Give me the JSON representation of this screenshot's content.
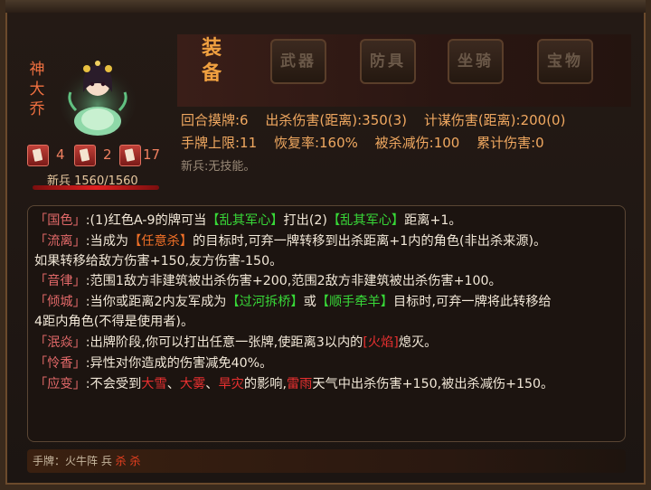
{
  "general": {
    "name": "神大乔",
    "stats": [
      {
        "icon": "card-icon",
        "value": "4"
      },
      {
        "icon": "sword-icon",
        "value": "2"
      },
      {
        "icon": "shield-icon",
        "value": "17"
      }
    ],
    "hp_label": "新兵 1560/1560",
    "hp_fraction": 1.0
  },
  "equipment": {
    "title": "装备",
    "slots": [
      "武器",
      "防具",
      "坐骑",
      "宝物"
    ]
  },
  "attributes": {
    "row1": [
      "回合摸牌:6",
      "出杀伤害(距离):350(3)",
      "计谋伤害(距离):200(0)"
    ],
    "row2": [
      "手牌上限:11",
      "恢复率:160%",
      "被杀减伤:100",
      "累计伤害:0"
    ],
    "no_skill": "新兵:无技能。"
  },
  "skills": {
    "l1": {
      "name": "「国色」",
      "a": ":(1)红色A-9的牌可当",
      "b": "【乱其军心】",
      "c": "打出(2)",
      "d": "【乱其军心】",
      "e": "距离+1。"
    },
    "l2": {
      "name": "「流离」",
      "a": ":当成为",
      "b": "【任意杀】",
      "c": "的目标时,可弃一牌转移到出杀距离+1内的角色(非出杀来源)。"
    },
    "l3": {
      "a": "如果转移给敌方伤害+150,友方伤害-150。"
    },
    "l4": {
      "name": "「音律」",
      "a": ":范围1敌方非建筑被出杀伤害+200,范围2敌方非建筑被出杀伤害+100。"
    },
    "l5": {
      "name": "「倾城」",
      "a": ":当你或距离2内友军成为",
      "b": "【过河拆桥】",
      "c": "或",
      "d": "【顺手牵羊】",
      "e": "目标时,可弃一牌将此转移给"
    },
    "l6": {
      "a": "4距内角色(不得是使用者)。"
    },
    "l7": {
      "name": "「泯焱」",
      "a": ":出牌阶段,你可以打出任意一张牌,使距离3以内的",
      "b": "[火焰]",
      "c": "熄灭。"
    },
    "l8": {
      "name": "「怜香」",
      "a": ":异性对你造成的伤害减免40%。"
    },
    "l9": {
      "name": "「应变」",
      "a": ":不会受到",
      "b": "大雪",
      "c": "、",
      "d": "大雾",
      "e": "、",
      "f": "旱灾",
      "g": "的影响,",
      "h": "雷雨",
      "i": "天气中出杀伤害+150,被出杀减伤+150。"
    }
  },
  "hand": {
    "label": "手牌：火牛阵  兵",
    "k1": "杀",
    "k2": "杀"
  }
}
